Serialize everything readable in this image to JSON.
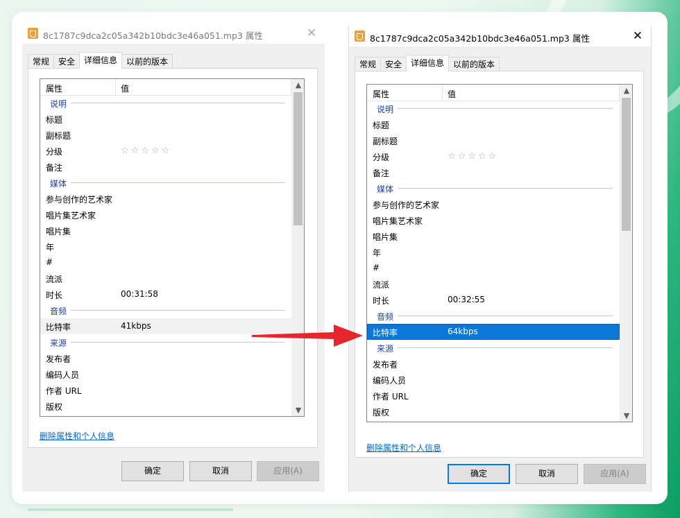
{
  "left_dialog": {
    "title": "8c1787c9dca2c05a342b10bdc3e46a051.mp3 属性",
    "close": "✕",
    "tabs": [
      "常规",
      "安全",
      "详细信息",
      "以前的版本"
    ],
    "header": {
      "name": "属性",
      "value": "值"
    },
    "rows": [
      {
        "k": "说明",
        "type": "group"
      },
      {
        "k": "标题"
      },
      {
        "k": "副标题"
      },
      {
        "k": "分级",
        "v": "☆☆☆☆☆",
        "stars": true
      },
      {
        "k": "备注"
      },
      {
        "k": "媒体",
        "type": "group"
      },
      {
        "k": "参与创作的艺术家"
      },
      {
        "k": "唱片集艺术家"
      },
      {
        "k": "唱片集"
      },
      {
        "k": "年"
      },
      {
        "k": "#"
      },
      {
        "k": "流派"
      },
      {
        "k": "时长",
        "v": "00:31:58"
      },
      {
        "k": "音频",
        "type": "group"
      },
      {
        "k": "比特率",
        "v": "41kbps",
        "state": "dim"
      },
      {
        "k": "来源",
        "type": "group"
      },
      {
        "k": "发布者"
      },
      {
        "k": "编码人员"
      },
      {
        "k": "作者 URL"
      },
      {
        "k": "版权"
      }
    ],
    "link": "删除属性和个人信息",
    "buttons": {
      "ok": "确定",
      "cancel": "取消",
      "apply": "应用(A)"
    }
  },
  "right_dialog": {
    "title": "8c1787c9dca2c05a342b10bdc3e46a051.mp3 属性",
    "close": "✕",
    "tabs": [
      "常规",
      "安全",
      "详细信息",
      "以前的版本"
    ],
    "header": {
      "name": "属性",
      "value": "值"
    },
    "rows": [
      {
        "k": "说明",
        "type": "group"
      },
      {
        "k": "标题"
      },
      {
        "k": "副标题"
      },
      {
        "k": "分级",
        "v": "☆☆☆☆☆",
        "stars": true
      },
      {
        "k": "备注"
      },
      {
        "k": "媒体",
        "type": "group"
      },
      {
        "k": "参与创作的艺术家"
      },
      {
        "k": "唱片集艺术家"
      },
      {
        "k": "唱片集"
      },
      {
        "k": "年"
      },
      {
        "k": "#"
      },
      {
        "k": "流派"
      },
      {
        "k": "时长",
        "v": "00:32:55"
      },
      {
        "k": "音频",
        "type": "group"
      },
      {
        "k": "比特率",
        "v": "64kbps",
        "state": "selected"
      },
      {
        "k": "来源",
        "type": "group"
      },
      {
        "k": "发布者"
      },
      {
        "k": "编码人员"
      },
      {
        "k": "作者 URL"
      },
      {
        "k": "版权"
      }
    ],
    "link": "删除属性和个人信息",
    "buttons": {
      "ok": "确定",
      "cancel": "取消",
      "apply": "应用(A)"
    }
  },
  "colors": {
    "accent": "#0b78d7",
    "group_text": "#1e3fa8",
    "arrow": "#e5262c"
  },
  "icons": {
    "file": "audio-file-icon",
    "up": "▲",
    "down": "▼"
  }
}
